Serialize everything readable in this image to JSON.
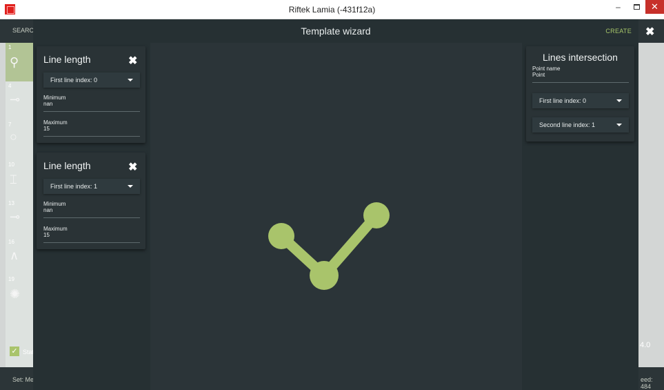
{
  "window": {
    "title": "Riftek Lamia (-431f12a)",
    "minimize_glyph": "–",
    "close_glyph": "✕"
  },
  "background_app": {
    "search_label": "SEARC",
    "sidebar_numbers": [
      "1",
      "4",
      "7",
      "10",
      "13",
      "16",
      "19"
    ],
    "status_label": "Stat",
    "set_label": "Set: Me",
    "speed_label": "eed: 484",
    "value_label": "4.0"
  },
  "wizard": {
    "title": "Template wizard",
    "create_label": "CREATE",
    "close_glyph": "✖",
    "left_cards": [
      {
        "title": "Line length",
        "dropdown": "First line index: 0",
        "minimum_label": "Minimum",
        "minimum_value": "nan",
        "maximum_label": "Maximum",
        "maximum_value": "15"
      },
      {
        "title": "Line length",
        "dropdown": "First line index: 1",
        "minimum_label": "Minimum",
        "minimum_value": "nan",
        "maximum_label": "Maximum",
        "maximum_value": "15"
      }
    ],
    "right_card": {
      "title": "Lines intersection",
      "point_name_label": "Point name",
      "point_name_value": "Point",
      "first_dropdown": "First line index: 0",
      "second_dropdown": "Second line index: 1"
    }
  },
  "colors": {
    "accent": "#a8c76a",
    "panel": "#2b3438",
    "shape": "#a9c46b"
  },
  "icons": {
    "card_close": "close-icon",
    "dropdown_caret": "caret-down-icon",
    "app_logo": "app-logo-icon"
  }
}
